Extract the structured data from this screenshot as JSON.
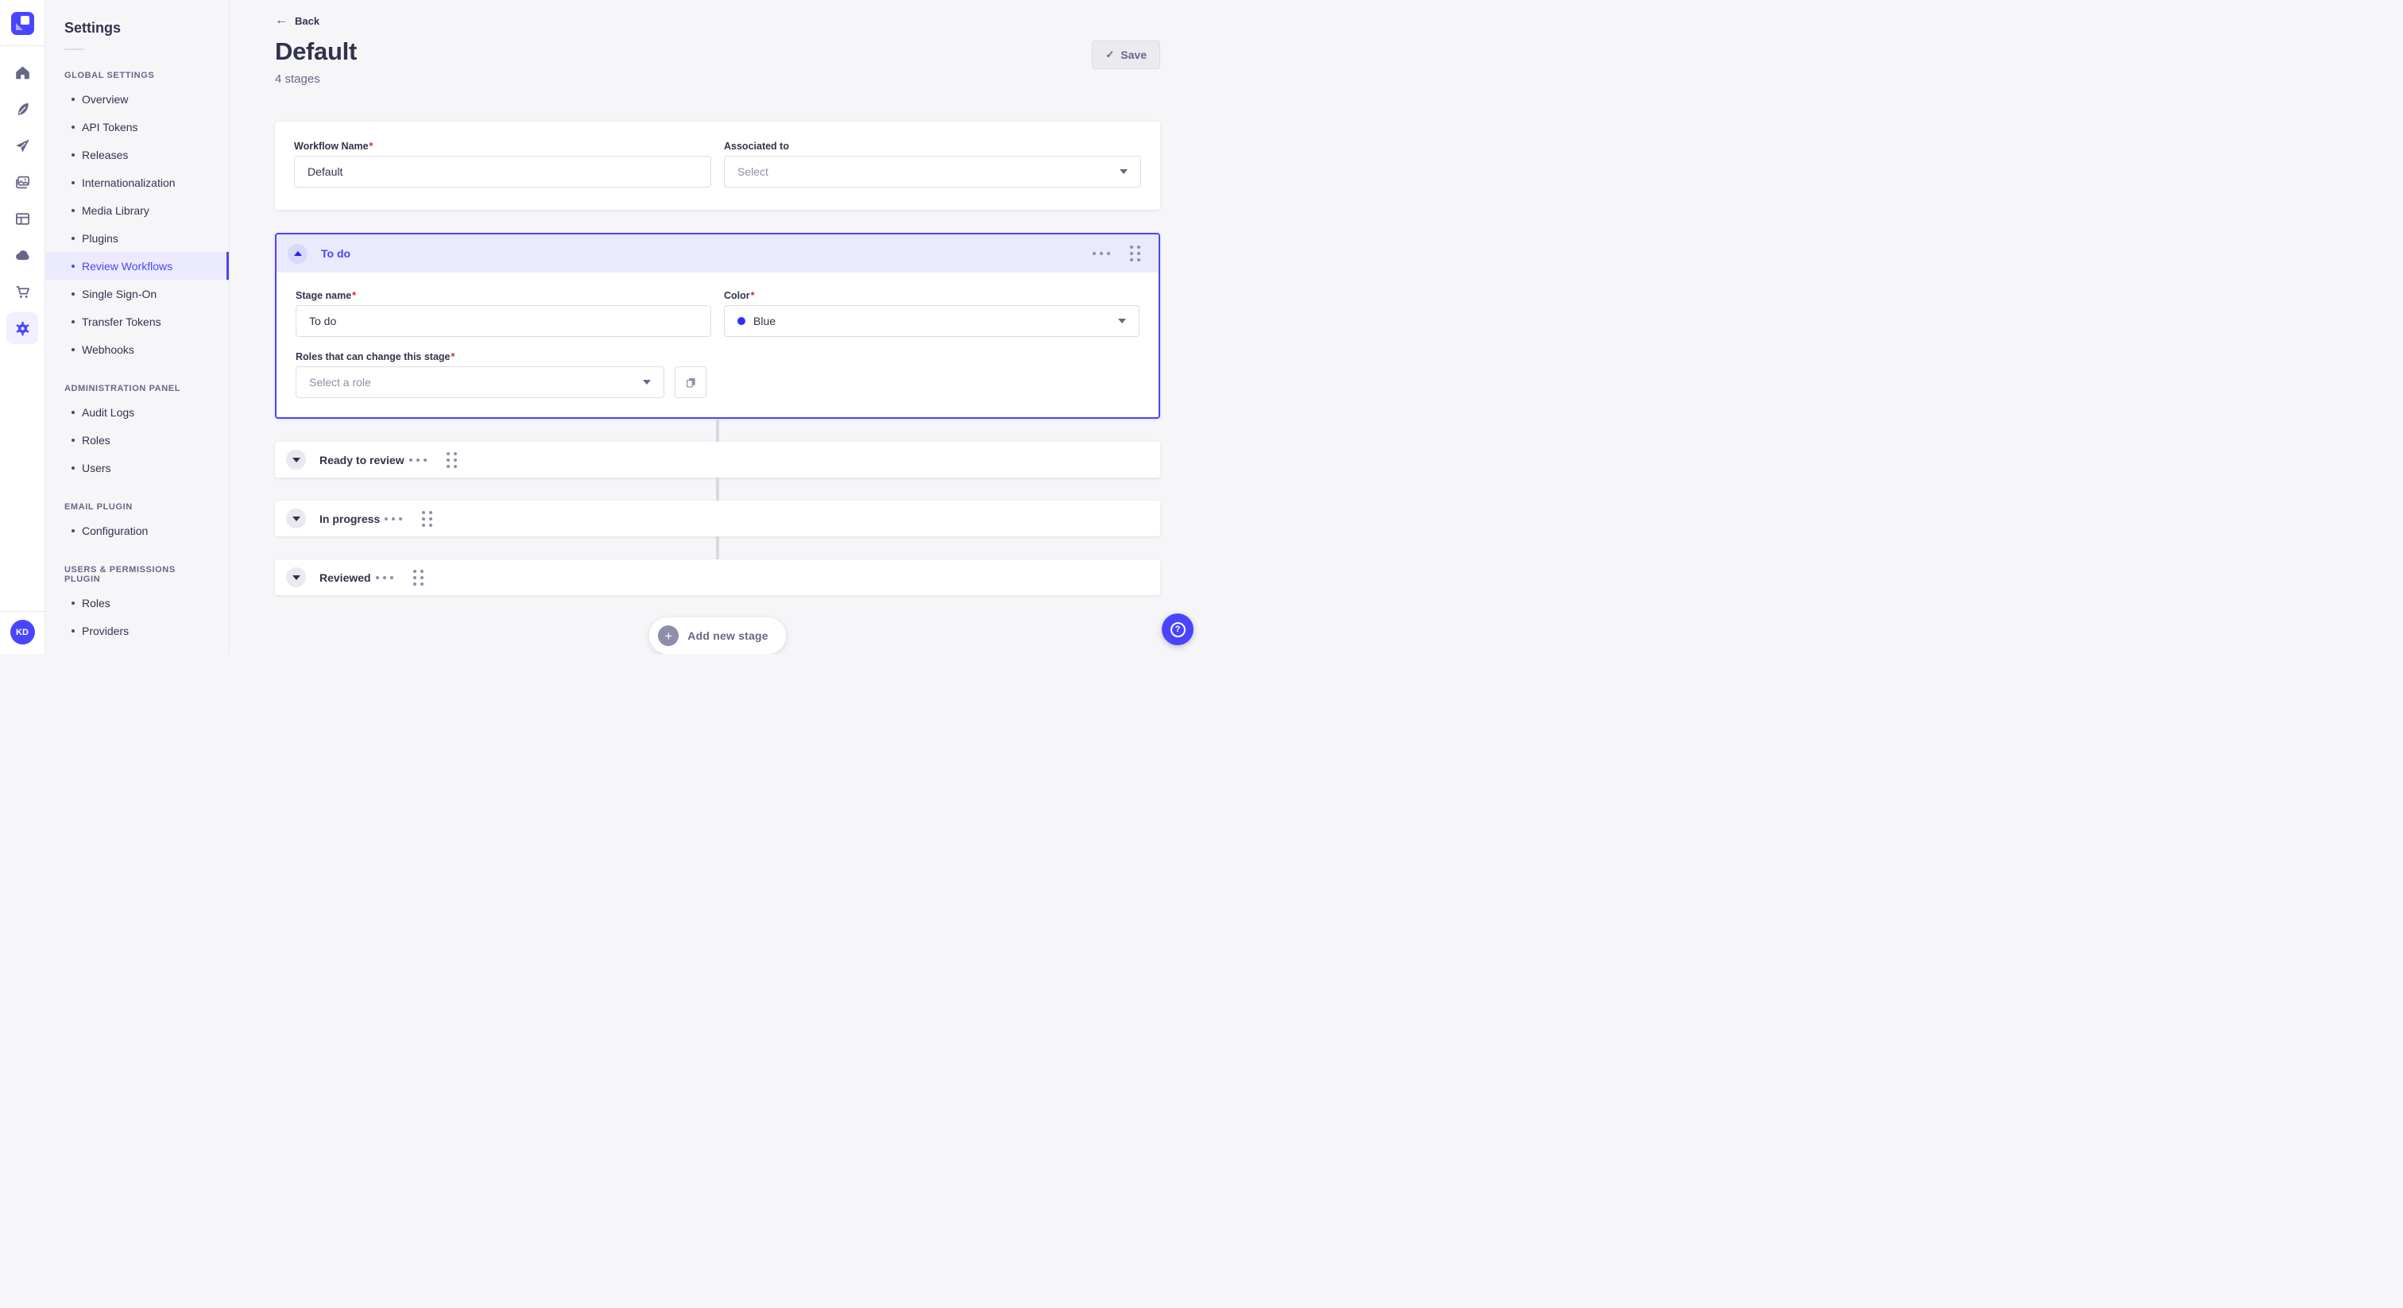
{
  "misc": {
    "required_mark": "*"
  },
  "colors": {
    "accent": "#4945ff",
    "accent_light": "#eaeafd",
    "stage_blue_dot": "#2f2fff",
    "danger": "#d02b20"
  },
  "rail": {
    "icons": [
      "home-icon",
      "feather-icon",
      "send-icon",
      "media-icon",
      "layout-icon",
      "cloud-icon",
      "cart-icon",
      "settings-icon"
    ],
    "avatar_initials": "KD"
  },
  "subnav": {
    "title": "Settings",
    "sections": [
      {
        "label": "GLOBAL SETTINGS",
        "items": [
          {
            "label": "Overview"
          },
          {
            "label": "API Tokens"
          },
          {
            "label": "Releases"
          },
          {
            "label": "Internationalization"
          },
          {
            "label": "Media Library"
          },
          {
            "label": "Plugins"
          },
          {
            "label": "Review Workflows",
            "active": true
          },
          {
            "label": "Single Sign-On"
          },
          {
            "label": "Transfer Tokens"
          },
          {
            "label": "Webhooks"
          }
        ]
      },
      {
        "label": "ADMINISTRATION PANEL",
        "items": [
          {
            "label": "Audit Logs"
          },
          {
            "label": "Roles"
          },
          {
            "label": "Users"
          }
        ]
      },
      {
        "label": "EMAIL PLUGIN",
        "items": [
          {
            "label": "Configuration"
          }
        ]
      },
      {
        "label": "USERS & PERMISSIONS PLUGIN",
        "items": [
          {
            "label": "Roles"
          },
          {
            "label": "Providers"
          }
        ]
      }
    ]
  },
  "header": {
    "back_label": "Back",
    "title": "Default",
    "subtitle": "4 stages",
    "save_label": "Save",
    "save_check": "✓"
  },
  "workflow_form": {
    "name_label": "Workflow Name",
    "name_value": "Default",
    "associated_label": "Associated to",
    "associated_value": "Select"
  },
  "stage_expanded": {
    "title": "To do",
    "name_label": "Stage name",
    "name_value": "To do",
    "color_label": "Color",
    "color_value": "Blue",
    "roles_label": "Roles that can change this stage",
    "roles_placeholder": "Select a role"
  },
  "stages_collapsed": [
    {
      "title": "Ready to review"
    },
    {
      "title": "In progress"
    },
    {
      "title": "Reviewed"
    }
  ],
  "add_stage_label": "Add new stage",
  "help": {
    "glyph": "?"
  }
}
